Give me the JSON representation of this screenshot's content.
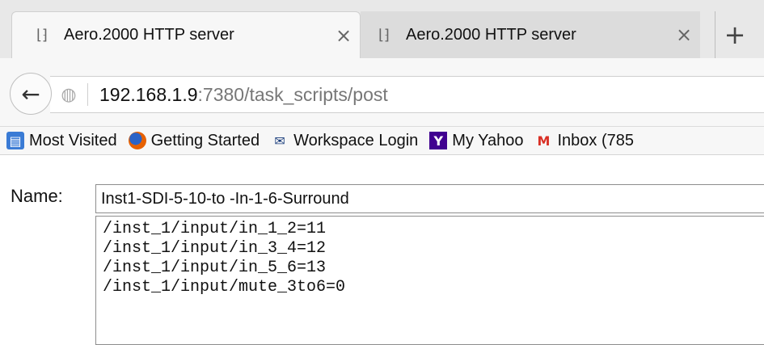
{
  "tabs": [
    {
      "title": "Aero.2000 HTTP server",
      "icon": "page-icon",
      "close": "×",
      "active": true
    },
    {
      "title": "Aero.2000 HTTP server",
      "icon": "page-icon",
      "close": "×",
      "active": false
    }
  ],
  "new_tab": "+",
  "nav": {
    "back": "←",
    "url_host": "192.168.1.9",
    "url_rest": ":7380/task_scripts/post"
  },
  "bookmarks": [
    {
      "label": "Most Visited",
      "icon": "most-visited-icon"
    },
    {
      "label": "Getting Started",
      "icon": "firefox-icon"
    },
    {
      "label": "Workspace Login",
      "icon": "mail-icon"
    },
    {
      "label": "My Yahoo",
      "icon": "yahoo-icon"
    },
    {
      "label": "Inbox (785",
      "icon": "gmail-icon"
    }
  ],
  "form": {
    "name_label": "Name:",
    "name_value": "Inst1-SDI-5-10-to -In-1-6-Surround",
    "script_lines": [
      "/inst_1/input/in_1_2=11",
      "/inst_1/input/in_3_4=12",
      "/inst_1/input/in_5_6=13",
      "/inst_1/input/mute_3to6=0"
    ]
  }
}
